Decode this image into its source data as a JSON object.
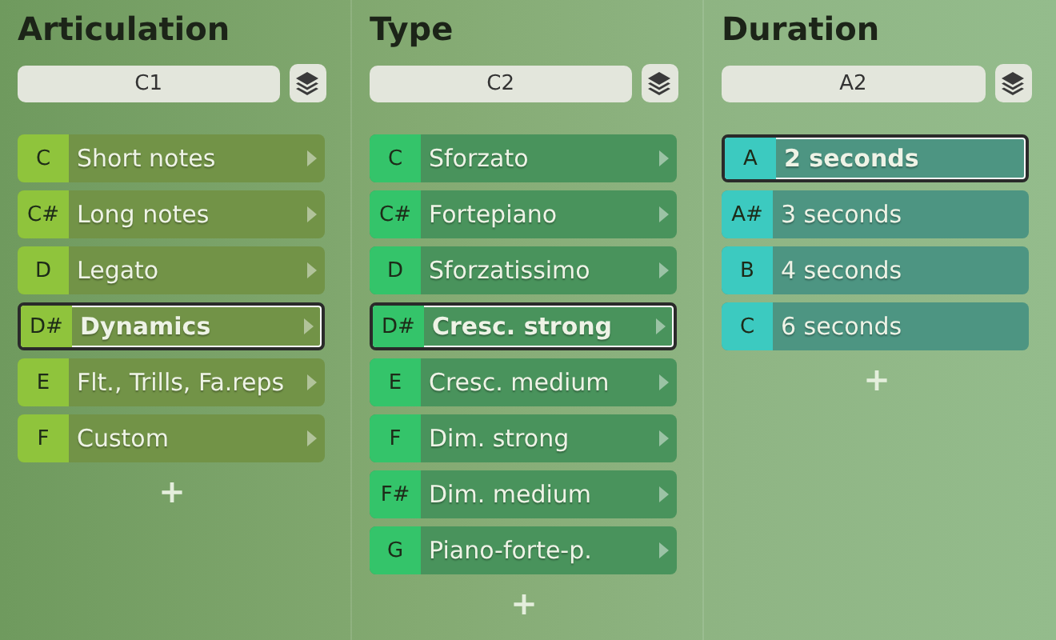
{
  "columns": [
    {
      "title": "Articulation",
      "field": "C1",
      "color": "#8fc43c",
      "arrows": true,
      "add": "+",
      "rows": [
        {
          "key": "C",
          "label": "Short notes",
          "selected": false
        },
        {
          "key": "C#",
          "label": "Long notes",
          "selected": false
        },
        {
          "key": "D",
          "label": "Legato",
          "selected": false
        },
        {
          "key": "D#",
          "label": "Dynamics",
          "selected": true
        },
        {
          "key": "E",
          "label": "Flt., Trills, Fa.reps",
          "selected": false
        },
        {
          "key": "F",
          "label": "Custom",
          "selected": false
        }
      ]
    },
    {
      "title": "Type",
      "field": "C2",
      "color": "#34c46a",
      "arrows": true,
      "add": "+",
      "rows": [
        {
          "key": "C",
          "label": "Sforzato",
          "selected": false
        },
        {
          "key": "C#",
          "label": "Fortepiano",
          "selected": false
        },
        {
          "key": "D",
          "label": "Sforzatissimo",
          "selected": false
        },
        {
          "key": "D#",
          "label": "Cresc. strong",
          "selected": true
        },
        {
          "key": "E",
          "label": "Cresc. medium",
          "selected": false
        },
        {
          "key": "F",
          "label": "Dim. strong",
          "selected": false
        },
        {
          "key": "F#",
          "label": "Dim. medium",
          "selected": false
        },
        {
          "key": "G",
          "label": "Piano-forte-p.",
          "selected": false
        }
      ]
    },
    {
      "title": "Duration",
      "field": "A2",
      "color": "#3ccac0",
      "arrows": false,
      "add": "+",
      "rows": [
        {
          "key": "A",
          "label": "2 seconds",
          "selected": true
        },
        {
          "key": "A#",
          "label": "3 seconds",
          "selected": false
        },
        {
          "key": "B",
          "label": "4 seconds",
          "selected": false
        },
        {
          "key": "C",
          "label": "6 seconds",
          "selected": false
        }
      ]
    }
  ]
}
